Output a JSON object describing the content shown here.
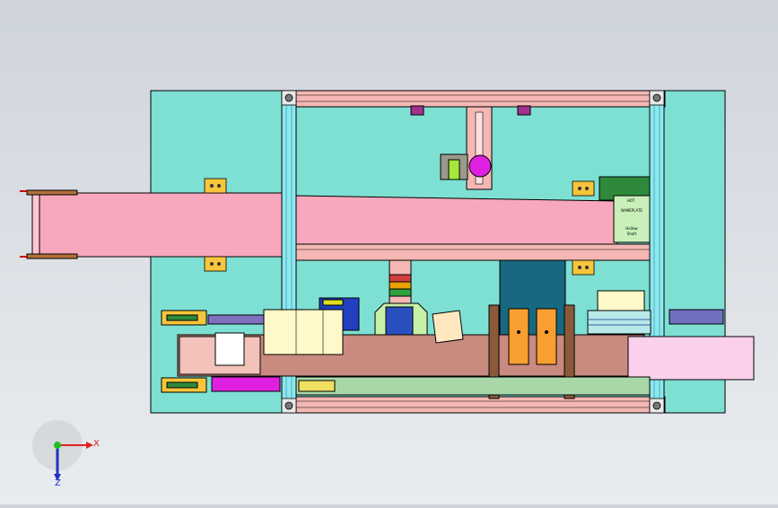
{
  "viewport": {
    "background": "#d9dde3",
    "base_plate_color": "#7ee0d3",
    "frame_color": "#f4b7b4",
    "conveyor_color": "#f7a8bc",
    "outline_color": "#000000"
  },
  "labels": {
    "motor_label_1": "HOT",
    "motor_label_2": "NAMEPLATE",
    "motor_label_3": "Hollow",
    "motor_label_4": "Shaft"
  },
  "triad": {
    "x_label": "X",
    "z_label": "Z",
    "x_color": "#e02020",
    "z_color": "#2030c0",
    "origin_color": "#20c020"
  }
}
